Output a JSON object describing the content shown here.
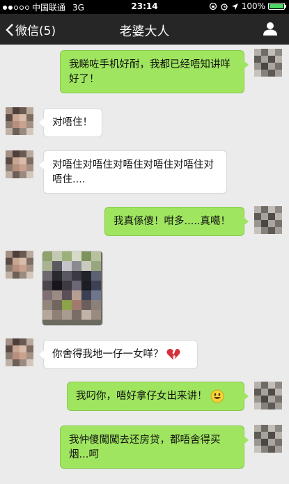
{
  "status_bar": {
    "carrier": "中国联通",
    "network": "3G",
    "time": "23:14",
    "battery": "100%"
  },
  "nav": {
    "back_label": "微信(5)",
    "title": "老婆大人"
  },
  "messages": [
    {
      "direction": "outgoing",
      "text": "我睇咗手机好耐，我都已经唔知讲咩好了！"
    },
    {
      "direction": "incoming",
      "text": "对唔住！"
    },
    {
      "direction": "incoming",
      "text": "对唔住对唔住对唔住对唔住对唔住对唔住...."
    },
    {
      "direction": "outgoing",
      "text": "我真係傻！咁多.....真噶！"
    },
    {
      "direction": "incoming",
      "type": "image"
    },
    {
      "direction": "incoming",
      "text": "你舍得我地一仔一女咩？",
      "emoji": "broken-heart"
    },
    {
      "direction": "outgoing",
      "text": "我叼你，唔好拿仔女出来讲！",
      "emoji": "smiley"
    },
    {
      "direction": "outgoing",
      "text": "我仲傻闖闖去还房贷，都唔舍得买烟...呵"
    }
  ],
  "colors": {
    "outgoing_bubble": "#9fe55f",
    "incoming_bubble": "#ffffff",
    "background": "#ebebeb",
    "navbar": "#262626"
  }
}
